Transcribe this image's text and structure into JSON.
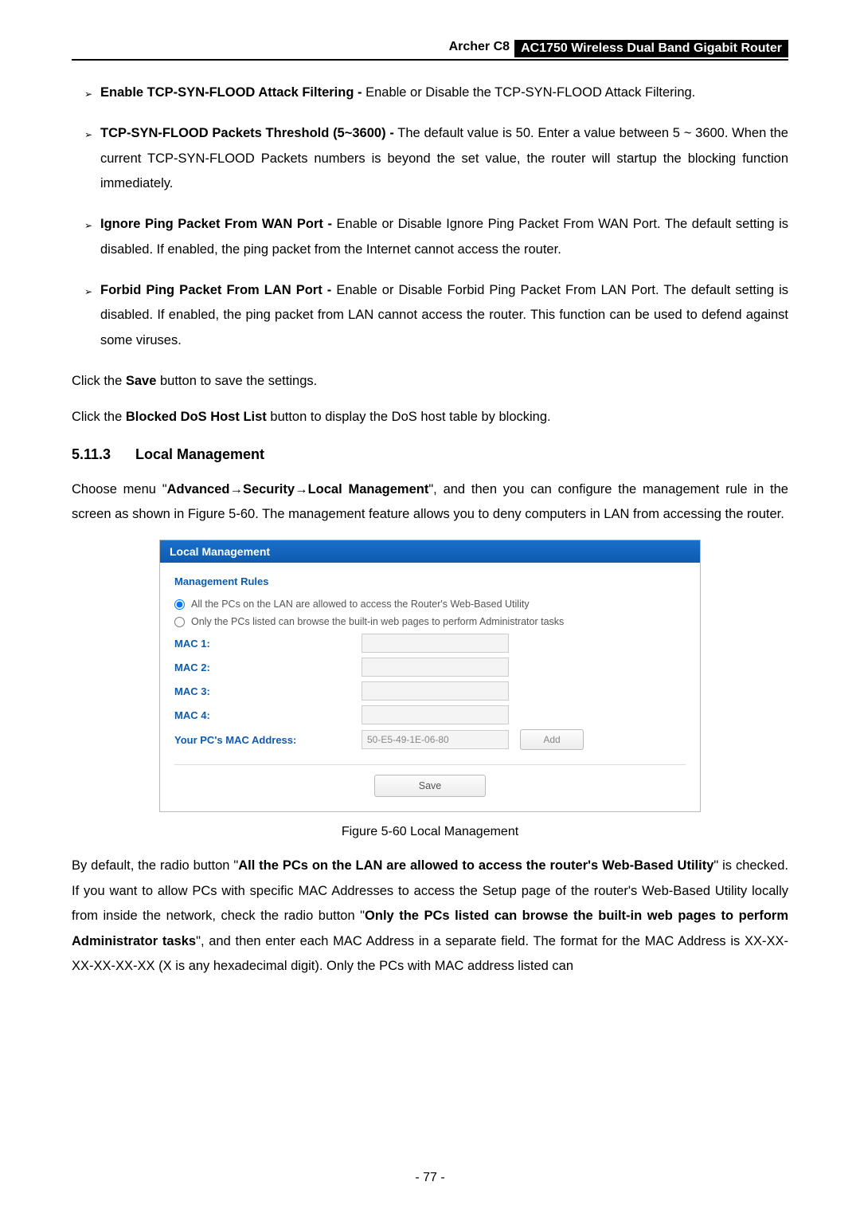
{
  "header": {
    "model": "Archer C8",
    "product": "AC1750 Wireless Dual Band Gigabit Router"
  },
  "items": {
    "b1": {
      "bold": "Enable TCP-SYN-FLOOD Attack Filtering -",
      "text": " Enable or Disable the TCP-SYN-FLOOD Attack Filtering."
    },
    "b2": {
      "bold": "TCP-SYN-FLOOD Packets Threshold (5~3600) -",
      "text": " The default value is 50. Enter a value between 5 ~ 3600. When the current TCP-SYN-FLOOD Packets numbers is beyond the set value, the router will startup the blocking function immediately."
    },
    "b3": {
      "bold": "Ignore Ping Packet From WAN Port -",
      "text": " Enable or Disable Ignore Ping Packet From WAN Port. The default setting is disabled. If enabled, the ping packet from the Internet cannot access the router."
    },
    "b4": {
      "bold": "Forbid Ping Packet From LAN Port -",
      "text": " Enable or Disable Forbid Ping Packet From LAN Port. The default setting is disabled. If enabled, the ping packet from LAN cannot access the router. This function can be used to defend against some viruses."
    }
  },
  "p": {
    "save": {
      "t1": "Click the ",
      "b1": "Save",
      "t2": " button to save the settings."
    },
    "blocked": {
      "t1": "Click the ",
      "b1": "Blocked DoS Host List",
      "t2": " button to display the DoS host table by blocking."
    },
    "choose": {
      "t1": "Choose menu \"",
      "b1": "Advanced",
      "arrow1": "→",
      "b2": "Security",
      "arrow2": "→",
      "b3": "Local Management",
      "t2": "\", and then you can configure the management rule in the screen as shown in Figure 5-60. The management feature allows you to deny computers in LAN from accessing the router."
    },
    "bydefault": {
      "t1": "By default, the radio button \"",
      "b1": "All the PCs on the LAN are allowed to access the router's Web-Based Utility",
      "t2": "\" is checked. If you want to allow PCs with specific MAC Addresses to access the Setup page of the router's Web-Based Utility locally from inside the network, check the radio button \"",
      "b2": "Only the PCs listed can browse the built-in web pages to perform Administrator tasks",
      "t3": "\", and then enter each MAC Address in a separate field. The format for the MAC Address is XX-XX-XX-XX-XX-XX (X is any hexadecimal digit). Only the PCs with MAC address listed can"
    }
  },
  "section": {
    "num": "5.11.3",
    "title": "Local Management"
  },
  "figure": {
    "header": "Local Management",
    "mgmtRules": "Management Rules",
    "radio1": "All the PCs on the LAN are allowed to access the Router's Web-Based Utility",
    "radio2": "Only the PCs listed can browse the built-in web pages to perform Administrator tasks",
    "mac1": "MAC 1:",
    "mac2": "MAC 2:",
    "mac3": "MAC 3:",
    "mac4": "MAC 4:",
    "yourpc": "Your PC's MAC Address:",
    "yourpc_value": "50-E5-49-1E-06-80",
    "addBtn": "Add",
    "saveBtn": "Save",
    "caption": "Figure 5-60 Local Management"
  },
  "pagenum": "- 77 -"
}
